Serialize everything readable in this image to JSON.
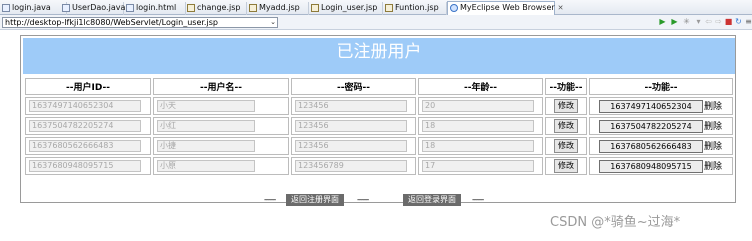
{
  "tabs": [
    {
      "label": "login.java",
      "icon": "java-file-icon"
    },
    {
      "label": "UserDao.java",
      "icon": "java-file-icon"
    },
    {
      "label": "login.html",
      "icon": "html-file-icon"
    },
    {
      "label": "change.jsp",
      "icon": "jsp-file-icon"
    },
    {
      "label": "Myadd.jsp",
      "icon": "jsp-file-icon"
    },
    {
      "label": "Login_user.jsp",
      "icon": "jsp-file-icon"
    },
    {
      "label": "Funtion.jsp",
      "icon": "jsp-file-icon"
    },
    {
      "label": "MyEclipse Web Browser",
      "icon": "globe-icon"
    }
  ],
  "address": {
    "url": "http://desktop-lfkji1lc8080/WebServlet/Login_user.jsp"
  },
  "page": {
    "banner": "已注册用户",
    "headers": [
      "--用户ID--",
      "--用户名--",
      "--密码--",
      "--年龄--",
      "--功能--",
      "--功能--"
    ],
    "edit_label": "修改",
    "delete_label": "删除",
    "rows": [
      {
        "id": "1637497140652304",
        "name": "小天",
        "password": "123456",
        "age": "20"
      },
      {
        "id": "1637504782205274",
        "name": "小红",
        "password": "123456",
        "age": "18"
      },
      {
        "id": "1637680562666483",
        "name": "小捷",
        "password": "123456",
        "age": "18"
      },
      {
        "id": "1637680948095715",
        "name": "小原",
        "password": "123456789",
        "age": "17"
      }
    ],
    "dashes": "------",
    "back_register": "返回注册界面",
    "back_login": "返回登录界面"
  },
  "watermark": "CSDN @*骑鱼~过海*",
  "colors": {
    "banner": "#9ecbf8",
    "nav_button": "#6b6b6b"
  }
}
